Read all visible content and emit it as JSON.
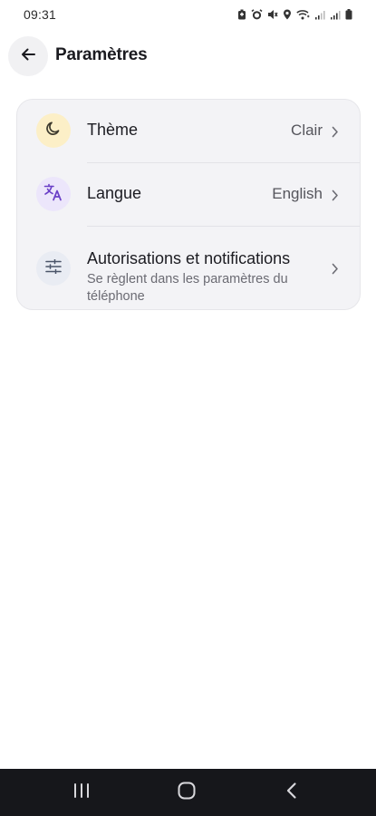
{
  "status_bar": {
    "time": "09:31",
    "icons": [
      "battery-saver-icon",
      "alarm-icon",
      "mute-icon",
      "location-icon",
      "wifi-icon",
      "signal-icon",
      "signal-icon",
      "battery-icon"
    ]
  },
  "header": {
    "back_icon": "arrow-left-icon",
    "title": "Paramètres"
  },
  "settings": {
    "items": [
      {
        "icon": "moon-icon",
        "label": "Thème",
        "value": "Clair",
        "icon_bg": "#fcefc7",
        "icon_color": "#3d3a2e"
      },
      {
        "icon": "translate-icon",
        "label": "Langue",
        "value": "English",
        "icon_bg": "#ece6fb",
        "icon_color": "#6a3fc7"
      },
      {
        "icon": "sliders-icon",
        "label": "Autorisations et notifications",
        "subtitle": "Se règlent dans les paramètres du téléphone",
        "icon_bg": "#e9ecf3",
        "icon_color": "#4a5468"
      }
    ]
  },
  "nav_bar": {
    "buttons": [
      "recents-icon",
      "home-icon",
      "back-icon"
    ]
  }
}
